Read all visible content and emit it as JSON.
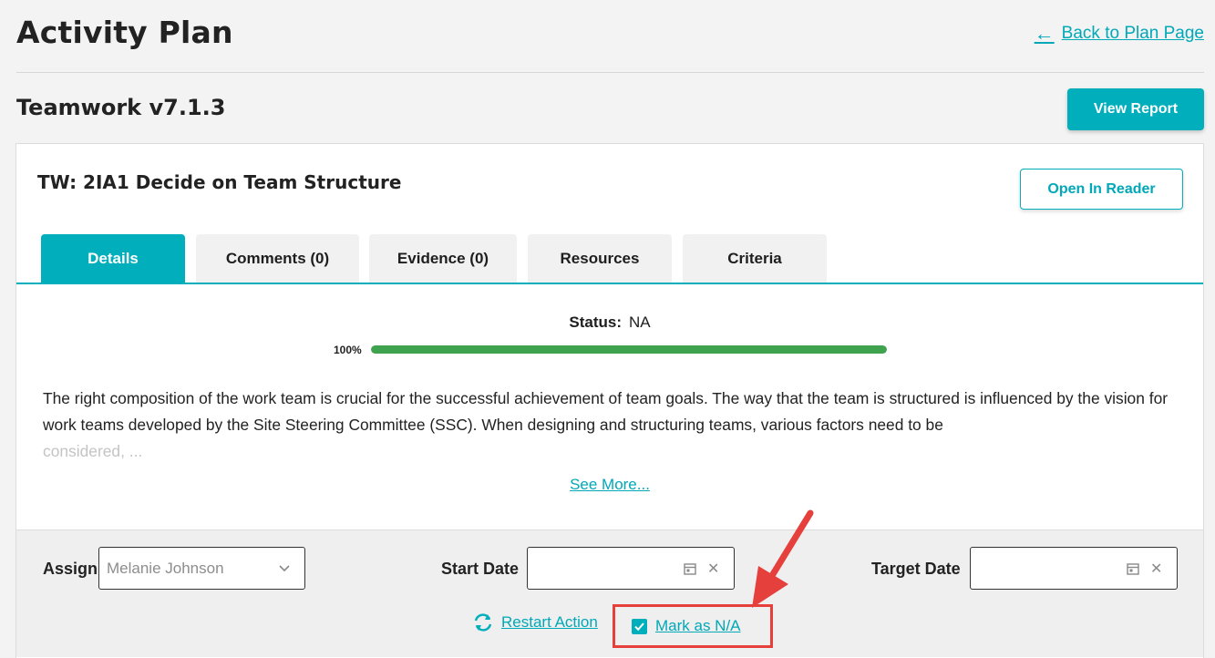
{
  "header": {
    "title": "Activity Plan",
    "back_link": "Back to Plan Page"
  },
  "plan": {
    "title": "Teamwork v7.1.3",
    "view_report": "View Report"
  },
  "activity": {
    "title": "TW: 2IA1 Decide on Team Structure",
    "open_in_reader": "Open In Reader",
    "tabs": [
      {
        "label": "Details",
        "active": true
      },
      {
        "label": "Comments (0)",
        "active": false
      },
      {
        "label": "Evidence (0)",
        "active": false
      },
      {
        "label": "Resources",
        "active": false
      },
      {
        "label": "Criteria",
        "active": false
      }
    ],
    "status_label": "Status:",
    "status_value": "NA",
    "progress_label": "100%",
    "progress_value": 100,
    "description": "The right composition of the work team is crucial for the successful achievement of team goals. The way that the team is structured is influenced by the vision for work teams developed by the Site Steering Committee (SSC). When designing and structuring teams, various factors need to be",
    "description_faded": "considered, ...",
    "see_more": "See More..."
  },
  "footer": {
    "assign_label": "Assign",
    "assign_value": "Melanie Johnson",
    "start_date_label": "Start Date",
    "start_date_value": "",
    "target_date_label": "Target Date",
    "target_date_value": "",
    "restart_action": "Restart Action",
    "mark_na": "Mark as N/A",
    "mark_na_checked": true
  },
  "colors": {
    "accent": "#00aebc",
    "progress": "#3ea24f",
    "highlight": "#e5403c"
  }
}
